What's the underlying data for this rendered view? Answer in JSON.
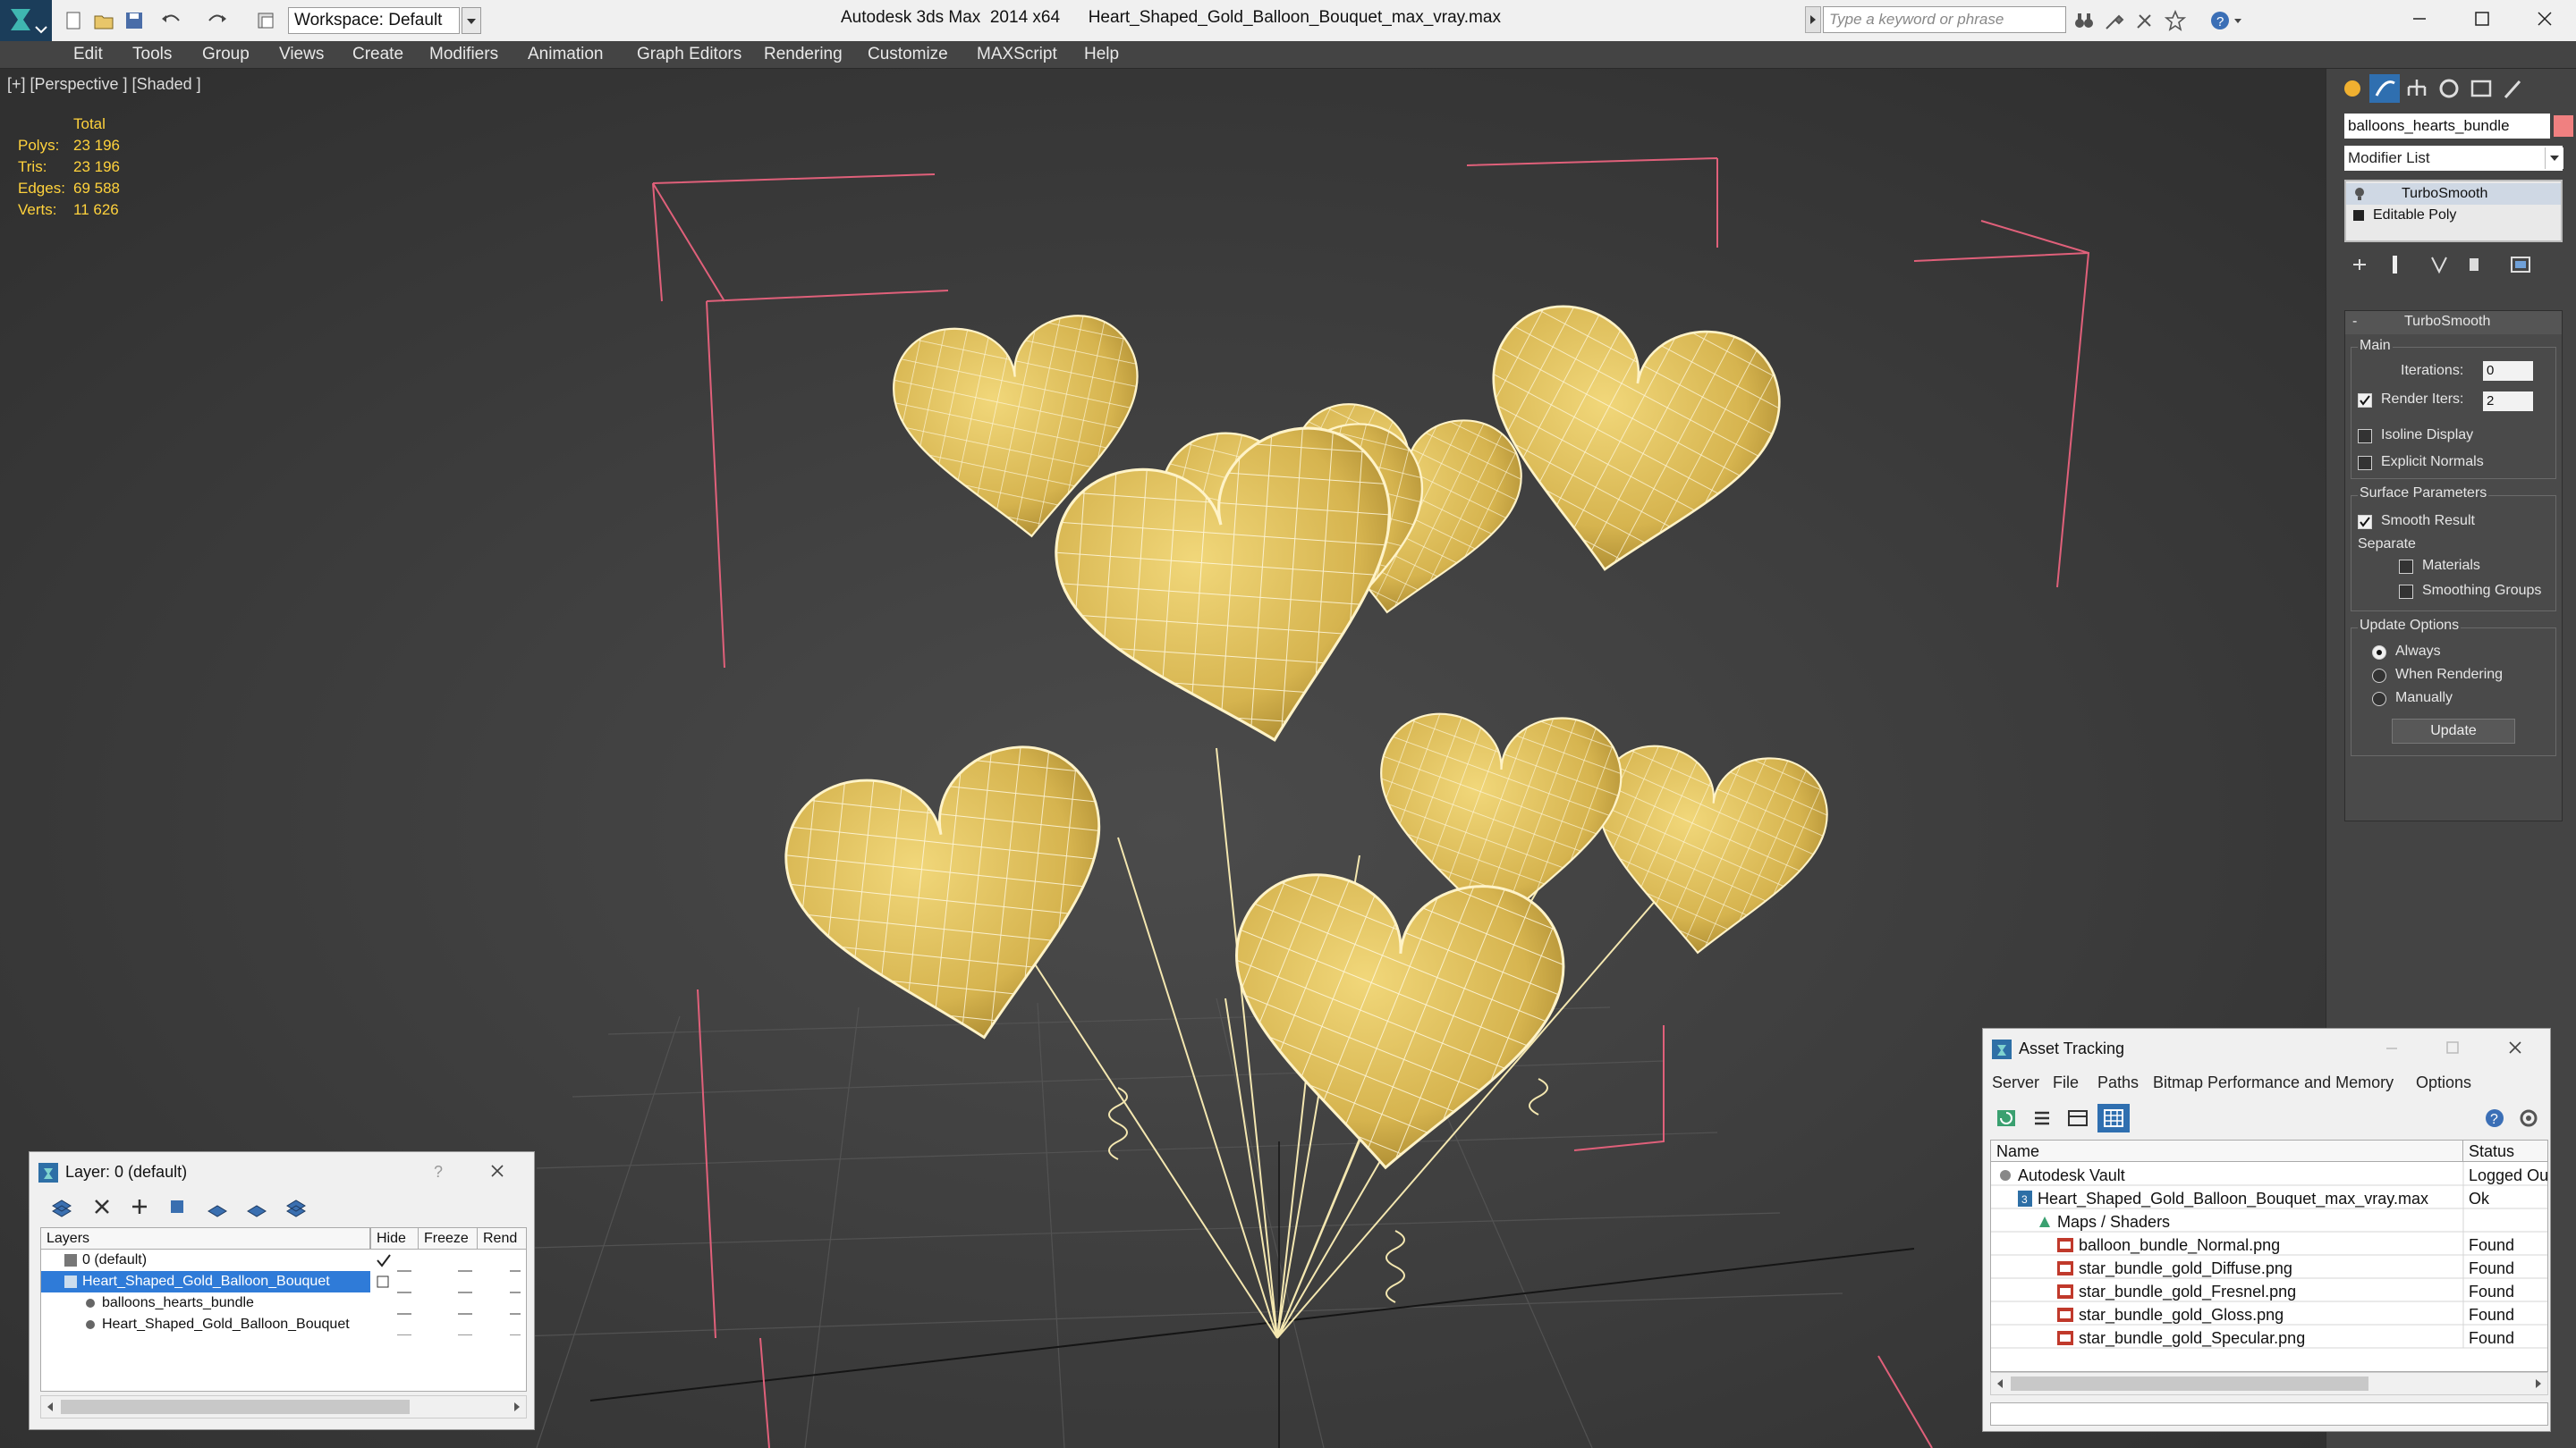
{
  "app": {
    "title": "Autodesk 3ds Max  2014 x64      Heart_Shaped_Gold_Balloon_Bouquet_max_vray.max",
    "workspace": "Workspace: Default",
    "search_placeholder": "Type a keyword or phrase"
  },
  "menu": [
    "Edit",
    "Tools",
    "Group",
    "Views",
    "Create",
    "Modifiers",
    "Animation",
    "Graph Editors",
    "Rendering",
    "Customize",
    "MAXScript",
    "Help"
  ],
  "viewport": {
    "label": "[+] [Perspective ] [Shaded ]",
    "stats": {
      "header": "Total",
      "rows": [
        {
          "label": "Polys:",
          "value": "23 196"
        },
        {
          "label": "Tris:",
          "value": "23 196"
        },
        {
          "label": "Edges:",
          "value": "69 588"
        },
        {
          "label": "Verts:",
          "value": "11 626"
        }
      ]
    },
    "balloon_color": "#dcbc59",
    "wire_color": "#ffffff",
    "bbox_color": "#e0607a"
  },
  "command_panel": {
    "object_name": "balloons_hearts_bundle",
    "object_color": "#f08080",
    "modifier_list": "Modifier List",
    "stack": [
      "TurboSmooth",
      "Editable Poly"
    ],
    "rollout": {
      "title": "TurboSmooth",
      "main_group": "Main",
      "iterations_label": "Iterations:",
      "iterations_value": "0",
      "render_iters_label": "Render Iters:",
      "render_iters_value": "2",
      "isoline": "Isoline Display",
      "explicit_normals": "Explicit Normals",
      "surface_group": "Surface Parameters",
      "smooth_result": "Smooth Result",
      "separate": "Separate",
      "materials": "Materials",
      "smoothing_groups": "Smoothing Groups",
      "update_group": "Update Options",
      "always": "Always",
      "when_rendering": "When Rendering",
      "manually": "Manually",
      "update_button": "Update"
    }
  },
  "layer_dialog": {
    "title": "Layer: 0 (default)",
    "columns": [
      "Layers",
      "Hide",
      "Freeze",
      "Rend"
    ],
    "rows": [
      {
        "name": "0 (default)",
        "indent": 0,
        "selected": false
      },
      {
        "name": "Heart_Shaped_Gold_Balloon_Bouquet",
        "indent": 0,
        "selected": true
      },
      {
        "name": "balloons_hearts_bundle",
        "indent": 1,
        "selected": false
      },
      {
        "name": "Heart_Shaped_Gold_Balloon_Bouquet",
        "indent": 1,
        "selected": false
      }
    ]
  },
  "asset_tracking": {
    "title": "Asset Tracking",
    "menu": [
      "Server",
      "File",
      "Paths",
      "Bitmap Performance and Memory",
      "Options"
    ],
    "columns": [
      "Name",
      "Status"
    ],
    "rows": [
      {
        "name": "Autodesk Vault",
        "status": "Logged Ou",
        "indent": 0
      },
      {
        "name": "Heart_Shaped_Gold_Balloon_Bouquet_max_vray.max",
        "status": "Ok",
        "indent": 1
      },
      {
        "name": "Maps / Shaders",
        "status": "",
        "indent": 2
      },
      {
        "name": "balloon_bundle_Normal.png",
        "status": "Found",
        "indent": 3
      },
      {
        "name": "star_bundle_gold_Diffuse.png",
        "status": "Found",
        "indent": 3
      },
      {
        "name": "star_bundle_gold_Fresnel.png",
        "status": "Found",
        "indent": 3
      },
      {
        "name": "star_bundle_gold_Gloss.png",
        "status": "Found",
        "indent": 3
      },
      {
        "name": "star_bundle_gold_Specular.png",
        "status": "Found",
        "indent": 3
      }
    ]
  }
}
